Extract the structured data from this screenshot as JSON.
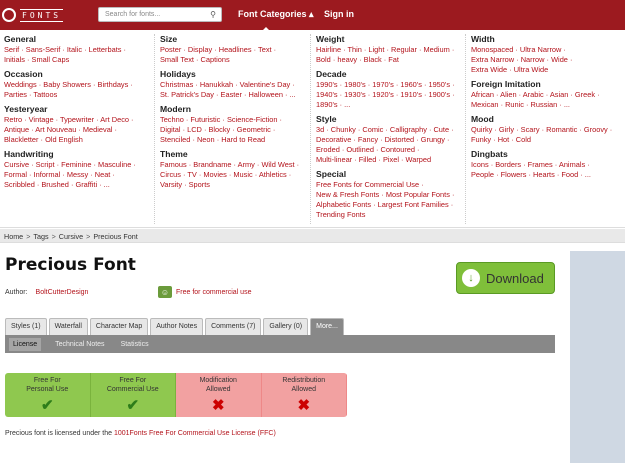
{
  "header": {
    "logo_text": "FONTS",
    "search_placeholder": "Search for fonts...",
    "nav": [
      "Font Categories",
      "Sign in"
    ]
  },
  "menu": {
    "columns": [
      [
        {
          "heading": "General",
          "lines": [
            "Serif · Sans-Serif · Italic · Letterbats ·",
            "Initials · Small Caps"
          ]
        },
        {
          "heading": "Occasion",
          "lines": [
            "Weddings · Baby Showers · Birthdays ·",
            "Parties · Tattoos"
          ]
        },
        {
          "heading": "Yesteryear",
          "lines": [
            "Retro · Vintage · Typewriter · Art Deco ·",
            "Antique · Art Nouveau · Medieval ·",
            "Blackletter · Old English"
          ]
        },
        {
          "heading": "Handwriting",
          "lines": [
            "Cursive · Script · Feminine · Masculine ·",
            "Formal · Informal · Messy · Neat ·",
            "Scribbled · Brushed · Graffiti · ..."
          ]
        }
      ],
      [
        {
          "heading": "Size",
          "lines": [
            "Poster · Display · Headlines · Text ·",
            "Small Text · Captions"
          ]
        },
        {
          "heading": "Holidays",
          "lines": [
            "Christmas · Hanukkah · Valentine's Day ·",
            "St. Patrick's Day · Easter · Halloween · ..."
          ]
        },
        {
          "heading": "Modern",
          "lines": [
            "Techno · Futuristic · Science-Fiction ·",
            "Digital · LCD · Blocky · Geometric ·",
            "Stenciled · Neon · Hard to Read"
          ]
        },
        {
          "heading": "Theme",
          "lines": [
            "Famous · Brandname · Army · Wild West ·",
            "Circus · TV · Movies · Music · Athletics ·",
            "Varsity · Sports"
          ]
        }
      ],
      [
        {
          "heading": "Weight",
          "lines": [
            "Hairline · Thin · Light · Regular · Medium ·",
            "Bold · heavy · Black · Fat"
          ]
        },
        {
          "heading": "Decade",
          "lines": [
            "1990's · 1980's · 1970's · 1960's · 1950's ·",
            "1940's · 1930's · 1920's · 1910's · 1900's ·",
            "1890's · ..."
          ]
        },
        {
          "heading": "Style",
          "lines": [
            "3d · Chunky · Comic · Calligraphy · Cute ·",
            "Decorative · Fancy · Distorted · Grungy ·",
            "Eroded · Outlined · Contoured ·",
            "Multi-linear · Filled · Pixel · Warped"
          ]
        },
        {
          "heading": "Special",
          "lines": [
            "Free Fonts for Commercial Use ·",
            "New & Fresh Fonts · Most Popular Fonts ·",
            "Alphabetic Fonts · Largest Font Families ·",
            "Trending Fonts"
          ]
        }
      ],
      [
        {
          "heading": "Width",
          "lines": [
            "Monospaced · Ultra Narrow ·",
            "Extra Narrow · Narrow · Wide ·",
            "Extra Wide · Ultra Wide"
          ]
        },
        {
          "heading": "Foreign Imitation",
          "lines": [
            "African · Alien · Arabic · Asian · Greek ·",
            "Mexican · Runic · Russian · ..."
          ]
        },
        {
          "heading": "Mood",
          "lines": [
            "Quirky · Girly · Scary · Romantic · Groovy ·",
            "Funky · Hot · Cold"
          ]
        },
        {
          "heading": "Dingbats",
          "lines": [
            "Icons · Borders · Frames · Animals ·",
            "People · Flowers · Hearts · Food · ..."
          ]
        }
      ]
    ]
  },
  "breadcrumb": [
    "Home",
    "Tags",
    "Cursive",
    "Precious Font"
  ],
  "font": {
    "title": "Precious Font",
    "author_label": "Author:",
    "author_name": "BoltCutterDesign",
    "license_badge": "Free for commercial use",
    "download_label": "Download"
  },
  "tabs": [
    "Styles (1)",
    "Waterfall",
    "Character Map",
    "Author Notes",
    "Comments (7)",
    "Gallery (0)",
    "More..."
  ],
  "subtabs": [
    "License",
    "Technical Notes",
    "Statistics"
  ],
  "license": [
    {
      "label": "Free For\nPersonal Use",
      "ok": true
    },
    {
      "label": "Free For\nCommercial Use",
      "ok": true
    },
    {
      "label": "Modification\nAllowed",
      "ok": false
    },
    {
      "label": "Redistribution\nAllowed",
      "ok": false
    }
  ],
  "license_line": {
    "prefix": "Precious font is licensed under the ",
    "link": "1001Fonts Free For Commercial Use License (FFC)"
  }
}
